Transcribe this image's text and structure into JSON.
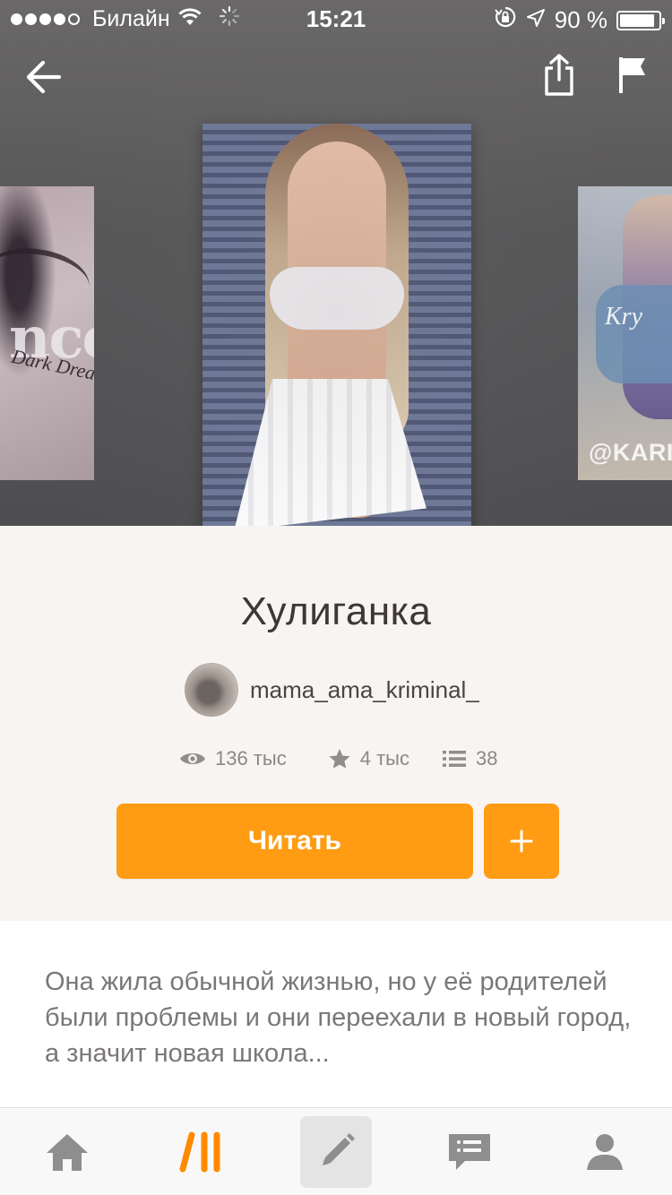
{
  "status_bar": {
    "signal_dots_filled": 4,
    "signal_dots_total": 5,
    "carrier": "Билайн",
    "time": "15:21",
    "battery_text": "90 %",
    "battery_level": 0.9,
    "icons": [
      "wifi-icon",
      "loading-spinner-icon",
      "orientation-lock-icon",
      "location-arrow-icon",
      "battery-icon"
    ]
  },
  "top_nav": {
    "back_icon": "arrow-left-icon",
    "share_icon": "share-icon",
    "report_icon": "flag-icon"
  },
  "covers": {
    "left": {
      "big_text": "nce",
      "sub_text": "Dark Dream"
    },
    "center": {},
    "right": {
      "script_text": "Kry",
      "watermark": "@KARIN"
    }
  },
  "story": {
    "title": "Хулиганка",
    "author": "mama_ama_kriminal_",
    "stats": {
      "reads": "136 тыс",
      "votes": "4 тыс",
      "parts": "38"
    },
    "read_label": "Читать",
    "add_label": "+",
    "description": "Она жила обычной жизнью, но у её родителей были проблемы и они переехали в новый город, а значит новая школа..."
  },
  "tab_bar": {
    "items": [
      {
        "name": "home",
        "icon": "home-icon"
      },
      {
        "name": "discover",
        "icon": "wattpad-logo-icon",
        "active": true
      },
      {
        "name": "write",
        "icon": "pencil-icon"
      },
      {
        "name": "messages",
        "icon": "chat-bubble-icon"
      },
      {
        "name": "profile",
        "icon": "person-icon"
      }
    ]
  },
  "colors": {
    "accent": "#ff9c13",
    "hero_bg": "#575657",
    "page_bg": "#f7f4f1",
    "title_text": "#3d3737",
    "muted_text": "#8b8888",
    "tab_icon": "#8e8e8e",
    "tab_active": "#ff8a00"
  }
}
